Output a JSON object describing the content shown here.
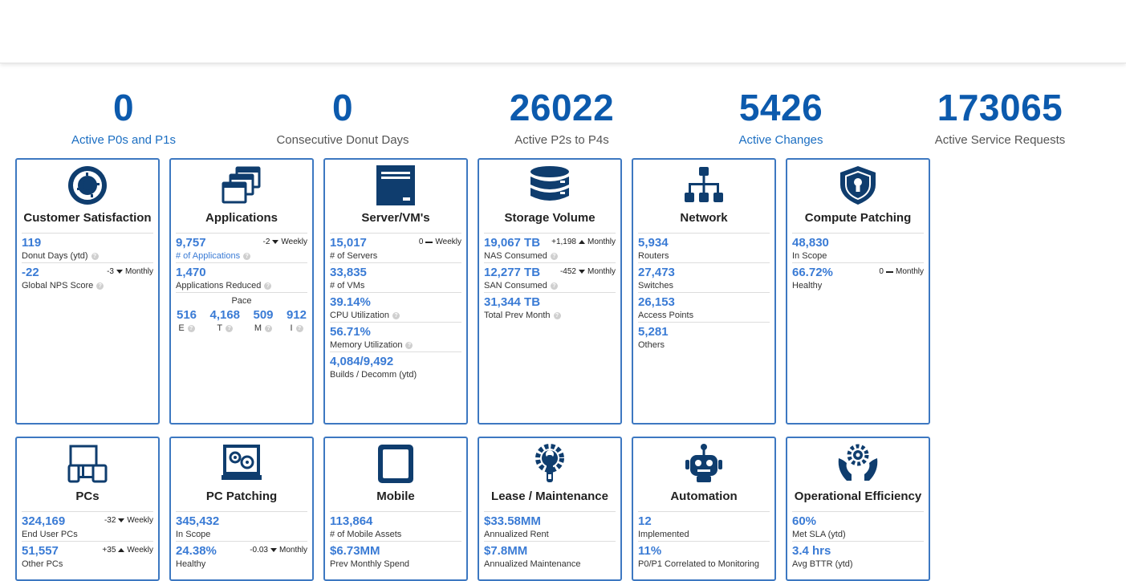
{
  "kpis": [
    {
      "value": "0",
      "label": "Active P0s and P1s"
    },
    {
      "value": "0",
      "label": "Consecutive Donut Days"
    },
    {
      "value": "26022",
      "label": "Active P2s to P4s"
    },
    {
      "value": "5426",
      "label": "Active Changes"
    },
    {
      "value": "173065",
      "label": "Active Service Requests"
    }
  ],
  "colors": {
    "accent": "#0c5aad",
    "metric": "#3a7bd5",
    "border": "#3d78c1",
    "icon": "#0f3d6e"
  },
  "cards": [
    {
      "title": "Customer Satisfaction",
      "icon": "donut-icon",
      "metrics": [
        {
          "value": "119",
          "label": "Donut Days (ytd)"
        },
        {
          "value": "-22",
          "label": "Global NPS Score",
          "trend_value": "-3",
          "trend_period": "Monthly"
        }
      ]
    },
    {
      "title": "Applications",
      "icon": "stacked-windows-icon",
      "metrics": [
        {
          "value": "9,757",
          "label": "# of Applications",
          "trend_value": "-2",
          "trend_period": "Weekly"
        },
        {
          "value": "1,470",
          "label": "Applications Reduced"
        }
      ],
      "pace": {
        "title": "Pace",
        "items": [
          {
            "value": "516",
            "label": "E"
          },
          {
            "value": "4,168",
            "label": "T"
          },
          {
            "value": "509",
            "label": "M"
          },
          {
            "value": "912",
            "label": "I"
          }
        ]
      }
    },
    {
      "title": "Server/VM's",
      "icon": "server-icon",
      "metrics": [
        {
          "value": "15,017",
          "label": "# of Servers",
          "trend_value": "0",
          "trend_period": "Weekly"
        },
        {
          "value": "33,835",
          "label": "# of VMs"
        },
        {
          "value": "39.14%",
          "label": "CPU Utilization"
        },
        {
          "value": "56.71%",
          "label": "Memory Utilization"
        },
        {
          "value": "4,084/9,492",
          "label": "Builds / Decomm (ytd)"
        }
      ]
    },
    {
      "title": "Storage Volume",
      "icon": "database-icon",
      "metrics": [
        {
          "value": "19,067 TB",
          "label": "NAS Consumed",
          "trend_value": "+1,198",
          "trend_period": "Monthly"
        },
        {
          "value": "12,277 TB",
          "label": "SAN Consumed",
          "trend_value": "-452",
          "trend_period": "Monthly"
        },
        {
          "value": "31,344 TB",
          "label": "Total Prev Month"
        }
      ]
    },
    {
      "title": "Network",
      "icon": "network-tree-icon",
      "metrics": [
        {
          "value": "5,934",
          "label": "Routers"
        },
        {
          "value": "27,473",
          "label": "Switches"
        },
        {
          "value": "26,153",
          "label": "Access Points"
        },
        {
          "value": "5,281",
          "label": "Others"
        }
      ]
    },
    {
      "title": "Compute Patching",
      "icon": "shield-lock-icon",
      "metrics": [
        {
          "value": "48,830",
          "label": "In Scope"
        },
        {
          "value": "66.72%",
          "label": "Healthy",
          "trend_value": "0",
          "trend_period": "Monthly"
        }
      ]
    },
    {
      "title": "PCs",
      "icon": "devices-icon",
      "metrics": [
        {
          "value": "324,169",
          "label": "End User PCs",
          "trend_value": "-32",
          "trend_period": "Weekly"
        },
        {
          "value": "51,557",
          "label": "Other PCs",
          "trend_value": "+35",
          "trend_period": "Weekly"
        }
      ]
    },
    {
      "title": "PC Patching",
      "icon": "laptop-gears-icon",
      "metrics": [
        {
          "value": "345,432",
          "label": "In Scope"
        },
        {
          "value": "24.38%",
          "label": "Healthy",
          "trend_value": "-0.03",
          "trend_period": "Monthly"
        }
      ]
    },
    {
      "title": "Mobile",
      "icon": "tablet-icon",
      "metrics": [
        {
          "value": "113,864",
          "label": "# of Mobile Assets"
        },
        {
          "value": "$6.73MM",
          "label": "Prev Monthly Spend"
        }
      ]
    },
    {
      "title": "Lease / Maintenance",
      "icon": "wrench-gear-icon",
      "metrics": [
        {
          "value": "$33.58MM",
          "label": "Annualized Rent"
        },
        {
          "value": "$7.8MM",
          "label": "Annualized Maintenance"
        }
      ]
    },
    {
      "title": "Automation",
      "icon": "robot-icon",
      "metrics": [
        {
          "value": "12",
          "label": "Implemented"
        },
        {
          "value": "11%",
          "label": "P0/P1 Correlated to Monitoring"
        }
      ]
    },
    {
      "title": "Operational Efficiency",
      "icon": "hands-gear-icon",
      "metrics": [
        {
          "value": "60%",
          "label": "Met SLA (ytd)"
        },
        {
          "value": "3.4 hrs",
          "label": "Avg BTTR (ytd)"
        }
      ]
    }
  ]
}
